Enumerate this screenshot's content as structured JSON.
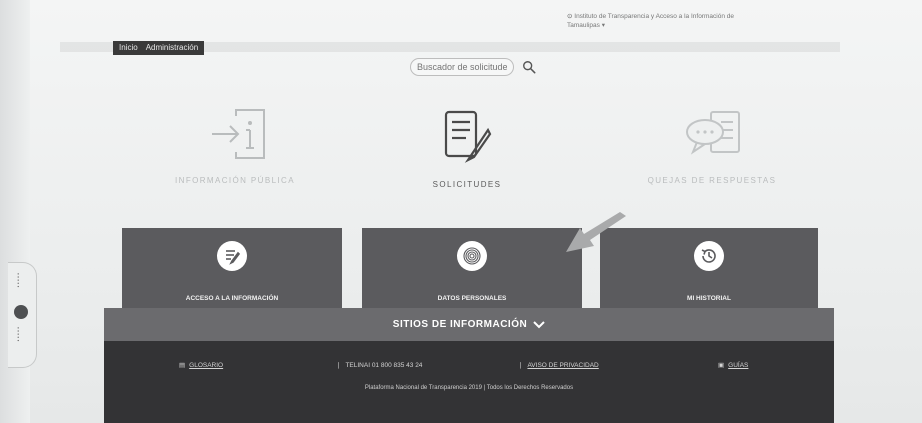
{
  "header": {
    "menu_items": [
      "Inicio",
      "Administración"
    ],
    "institution": "Instituto de Transparencia y Acceso a la Información de Tamaulipas",
    "search_placeholder": "Buscador de solicitude"
  },
  "categories": [
    {
      "label": "INFORMACIÓN PÚBLICA",
      "icon": "info-icon"
    },
    {
      "label": "SOLICITUDES",
      "icon": "request-document-icon"
    },
    {
      "label": "QUEJAS DE RESPUESTAS",
      "icon": "complaint-chat-icon"
    }
  ],
  "tiles": [
    {
      "label": "ACCESO A LA INFORMACIÓN",
      "icon": "edit-document-icon"
    },
    {
      "label": "DATOS PERSONALES",
      "icon": "fingerprint-icon"
    },
    {
      "label": "MI HISTORIAL",
      "icon": "history-clock-icon"
    }
  ],
  "info_sites": {
    "label": "SITIOS DE INFORMACIÓN"
  },
  "footer": {
    "links": [
      {
        "label": "GLOSARIO",
        "icon": "book-icon"
      },
      {
        "label": "TELINAI 01 800 835 43 24",
        "icon": "phone-icon"
      },
      {
        "label": "AVISO DE PRIVACIDAD",
        "icon": "document-icon"
      },
      {
        "label": "GUÍAS",
        "icon": "guide-icon"
      }
    ],
    "copyright": "Plataforma Nacional de Transparencia 2019 | Todos los Derechos Reservados"
  },
  "colors": {
    "tile_bg": "#5b5b5e",
    "strip_bg": "#6b6b6e",
    "footer_bg": "#333335",
    "muted_label": "#b9bcbd"
  }
}
